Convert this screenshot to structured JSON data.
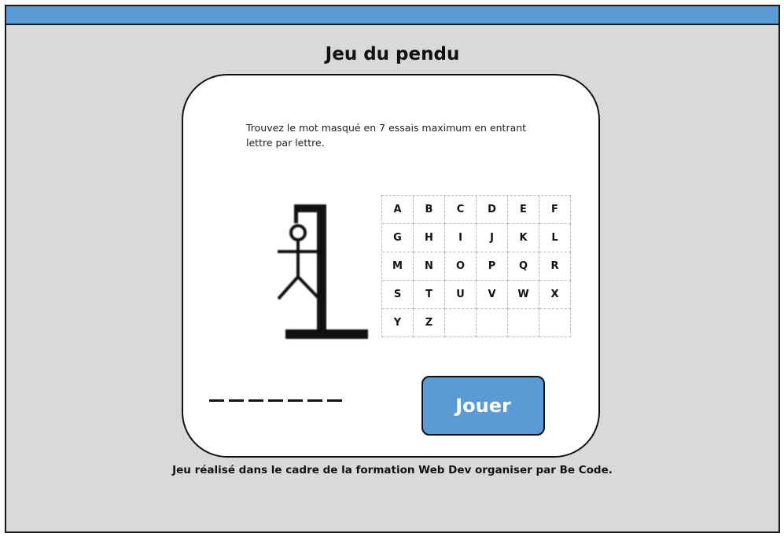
{
  "page_title": "Jeu du pendu",
  "instructions": "Trouvez le mot masqué en 7 essais maximum en entrant lettre par lettre.",
  "letters": [
    "A",
    "B",
    "C",
    "D",
    "E",
    "F",
    "G",
    "H",
    "I",
    "J",
    "K",
    "L",
    "M",
    "N",
    "O",
    "P",
    "Q",
    "R",
    "S",
    "T",
    "U",
    "V",
    "W",
    "X",
    "Y",
    "Z"
  ],
  "hidden_word_slots": 7,
  "play_button_label": "Jouer",
  "footer": "Jeu réalisé dans le cadre de la formation Web Dev organiser par Be Code.",
  "colors": {
    "accent": "#5b9bd5",
    "background": "#d9d9d9",
    "card": "#ffffff"
  },
  "icons": {
    "illustration": "hangman-icon"
  }
}
